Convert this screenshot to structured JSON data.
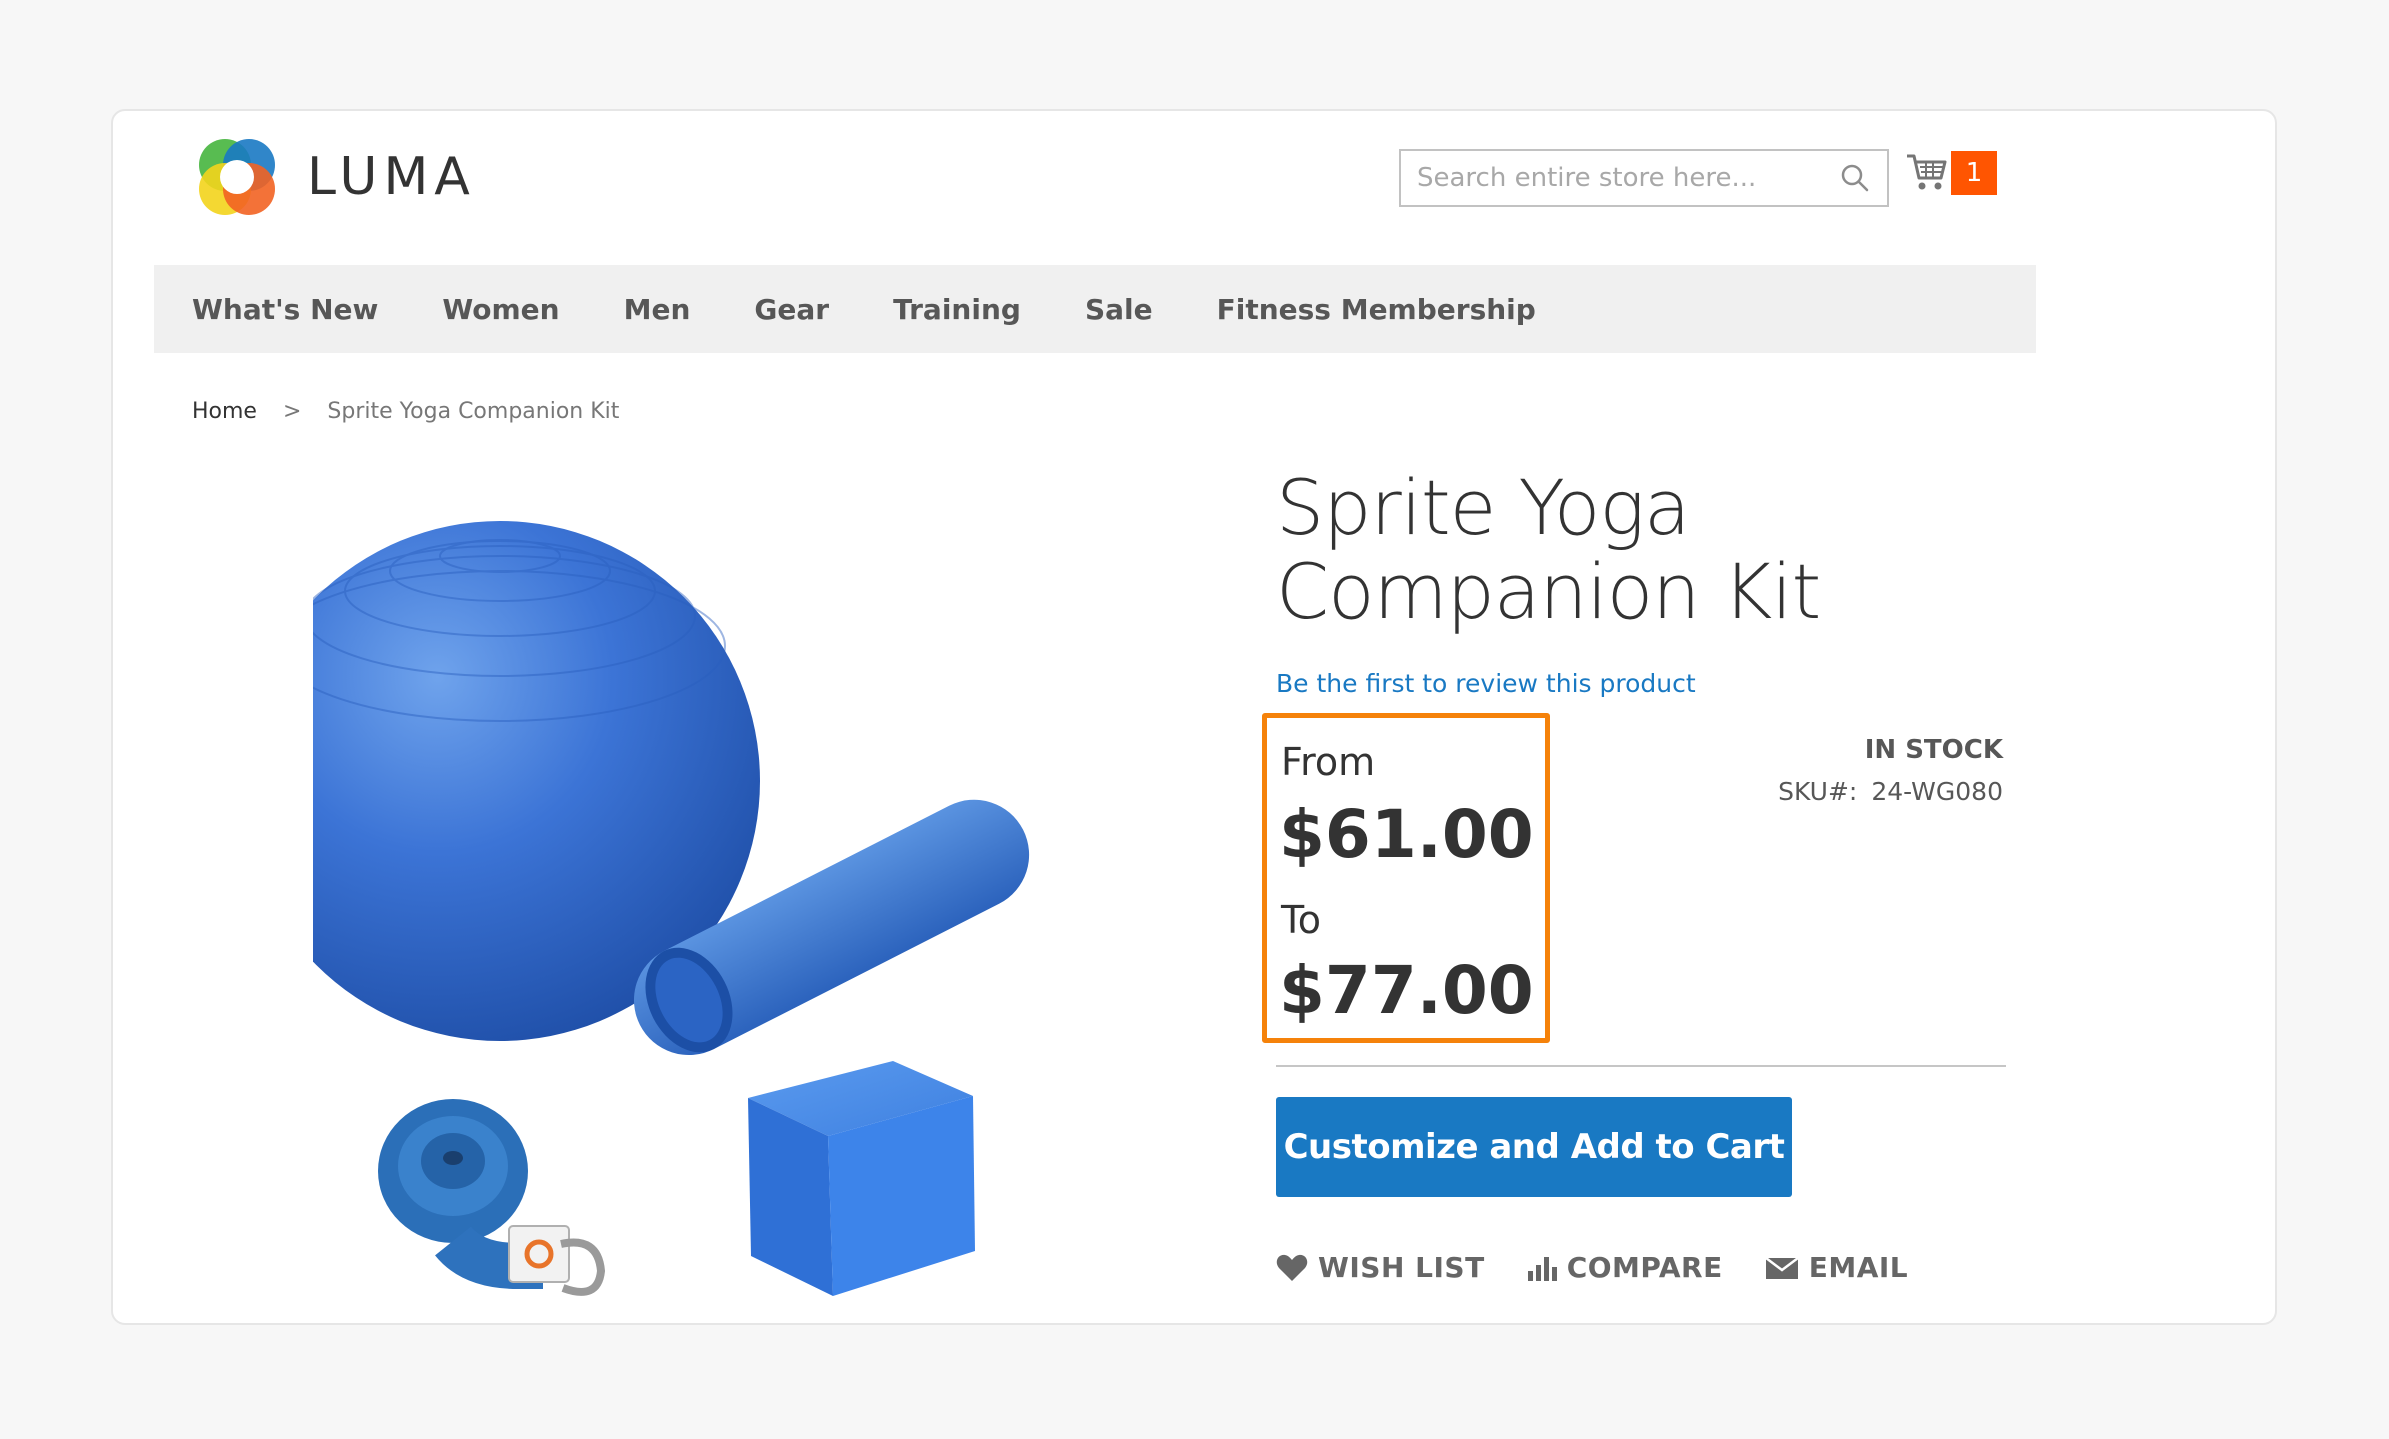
{
  "header": {
    "logo_text": "LUMA",
    "logo_icon": "luma-logo-icon",
    "search": {
      "placeholder": "Search entire store here...",
      "value": "",
      "icon": "search-icon"
    },
    "cart": {
      "icon": "cart-icon",
      "count": "1",
      "badge_color": "#ff5501"
    }
  },
  "nav": {
    "items": [
      "What's New",
      "Women",
      "Men",
      "Gear",
      "Training",
      "Sale",
      "Fitness Membership"
    ]
  },
  "breadcrumb": {
    "home": "Home",
    "separator": ">",
    "current": "Sprite Yoga Companion Kit"
  },
  "product": {
    "title": "Sprite Yoga Companion Kit",
    "review_link": "Be the first to review this product",
    "price": {
      "from_label": "From",
      "from_amount": "$61.00",
      "to_label": "To",
      "to_amount": "$77.00",
      "highlight_color": "#f5820a"
    },
    "stock": "IN STOCK",
    "sku_label": "SKU#:",
    "sku_value": "24-WG080",
    "add_to_cart": "Customize and Add to Cart",
    "button_color": "#1979c3",
    "actions": {
      "wishlist": {
        "label": "WISH LIST",
        "icon": "heart-icon"
      },
      "compare": {
        "label": "COMPARE",
        "icon": "bar-chart-icon"
      },
      "email": {
        "label": "EMAIL",
        "icon": "envelope-icon"
      }
    },
    "image": "product-image"
  }
}
